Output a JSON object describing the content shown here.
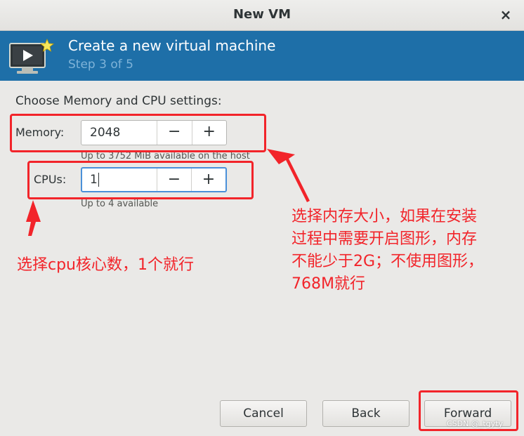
{
  "window": {
    "title": "New VM",
    "close_glyph": "×"
  },
  "banner": {
    "heading": "Create a new virtual machine",
    "step": "Step 3 of 5",
    "icon": "vm-screen-icon"
  },
  "form": {
    "section_title": "Choose Memory and CPU settings:",
    "memory": {
      "label": "Memory:",
      "value": "2048",
      "hint": "Up to 3752 MiB available on the host"
    },
    "cpus": {
      "label": "CPUs:",
      "value": "1",
      "hint": "Up to 4 available"
    },
    "minus_glyph": "−",
    "plus_glyph": "+"
  },
  "annotations": {
    "cpu_note": "选择cpu核心数，1个就行",
    "memory_note": [
      "选择内存大小，如果在安装",
      "过程中需要开启图形，内存",
      "不能少于2G；不使用图形，",
      "768M就行"
    ],
    "color": "#f2242a"
  },
  "footer": {
    "cancel_label": "Cancel",
    "back_label": "Back",
    "forward_label": "Forward"
  },
  "watermark": "CSDN @_tgyty"
}
